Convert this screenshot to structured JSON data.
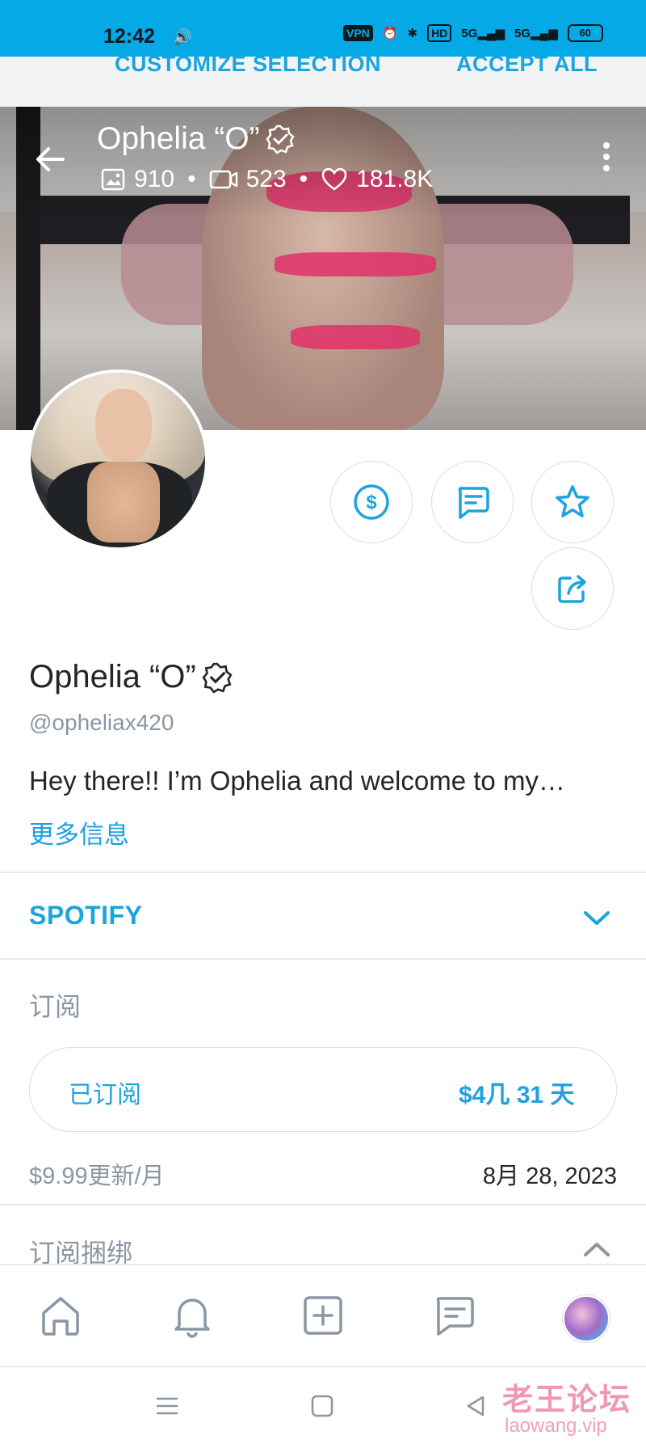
{
  "status_bar": {
    "time": "12:42",
    "vpn": "VPN",
    "hd": "HD",
    "signal1": "5G",
    "signal2": "5G",
    "battery": "60"
  },
  "cookie_banner": {
    "customize_label": "CUSTOMIZE SELECTION",
    "accept_label": "ACCEPT ALL"
  },
  "header": {
    "title": "Ophelia “O”",
    "photos_count": "910",
    "videos_count": "523",
    "likes_count": "181.8K",
    "separator": "•"
  },
  "profile": {
    "name": "Ophelia “O”",
    "handle": "@opheliax420",
    "bio": "Hey there!! I’m Ophelia and welcome to my…",
    "more_info_label": "更多信息"
  },
  "spotify": {
    "label": "SPOTIFY"
  },
  "subscription": {
    "section_label": "订阅",
    "status_label": "已订阅",
    "price_label": "$4几 31 天",
    "renew_label": "$9.99更新/月",
    "renew_date": "8月 28, 2023",
    "bundle_label": "订阅捆绑"
  },
  "watermark": {
    "text": "老王论坛",
    "url": "laowang.vip"
  },
  "colors": {
    "accent": "#1ca3e0",
    "status_bar": "#04a9e5",
    "muted": "#8a96a3"
  },
  "icons": {
    "back": "arrow-left-icon",
    "more": "kebab-menu-icon",
    "tip": "dollar-circle-icon",
    "message": "message-icon",
    "favorite": "star-icon",
    "share": "share-icon"
  }
}
